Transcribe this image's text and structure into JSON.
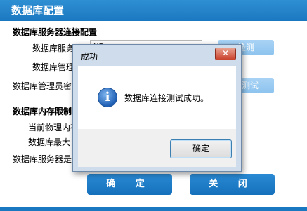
{
  "window": {
    "title": "数据库配置"
  },
  "connection_section": {
    "title": "数据库服务器连接配置",
    "server_label": "数据库服务器",
    "server_value": "XD",
    "admin_label": "数据库管理",
    "password_label": "数据库管理员密",
    "test_button": "检测",
    "test_conn_button": "接测试"
  },
  "memory_section": {
    "title": "数据库内存限制",
    "physical_label": "当前物理内存",
    "max_label": "数据库最大",
    "server_label": "数据库服务器是"
  },
  "footer": {
    "ok_label": "确 定",
    "close_label": "关 闭"
  },
  "dialog": {
    "title": "成功",
    "close_glyph": "✕",
    "message": "数据库连接测试成功。",
    "ok_label": "确定",
    "icon": "info-icon",
    "icon_glyph": "i"
  }
}
